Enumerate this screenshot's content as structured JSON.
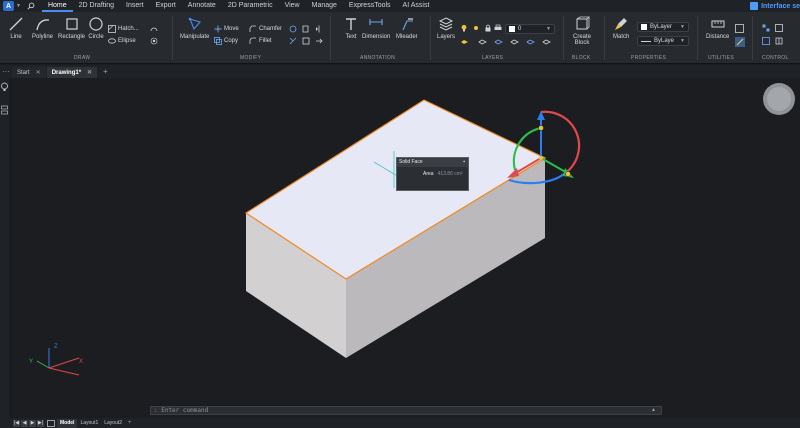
{
  "app": {
    "logo_letter": "A",
    "title_badge": "Interface se"
  },
  "menu": [
    "Home",
    "2D Drafting",
    "Insert",
    "Export",
    "Annotate",
    "2D Parametric",
    "View",
    "Manage",
    "ExpressTools",
    "AI Assist"
  ],
  "ribbon": {
    "draw": {
      "title": "DRAW",
      "line": "Line",
      "polyline": "Polyline",
      "rectangle": "Rectangle",
      "circle": "Circle",
      "hatch": "Hatch...",
      "ellipse": "Ellipse"
    },
    "modify": {
      "title": "MODIFY",
      "manipulate": "Manipulate",
      "move": "Move",
      "copy": "Copy",
      "chamfer": "Chamfer",
      "fillet": "Fillet"
    },
    "annotation": {
      "title": "ANNOTATION",
      "text": "Text",
      "dimension": "Dimension",
      "mleader": "Mleader"
    },
    "layers": {
      "title": "LAYERS",
      "layers": "Layers",
      "current_layer": "0"
    },
    "block": {
      "title": "BLOCK",
      "create": "Create",
      "block": "Block"
    },
    "properties": {
      "title": "PROPERTIES",
      "match": "Match",
      "color": "ByLayer",
      "linetype": "ByLaye"
    },
    "utilities": {
      "title": "UTILITIES",
      "distance": "Distance"
    },
    "control": {
      "title": "CONTROL"
    }
  },
  "doc_tabs": [
    {
      "label": "Start",
      "active": false
    },
    {
      "label": "Drawing1*",
      "active": true
    }
  ],
  "tooltip": {
    "title": "Solid Face",
    "key": "Area",
    "value": "413.86 cm²"
  },
  "ucs": {
    "x": "X",
    "y": "Y",
    "z": "Z"
  },
  "command": {
    "placeholder": ": Enter command"
  },
  "status": {
    "tabs": [
      "Model",
      "Layout1",
      "Layout2"
    ],
    "active": "Model"
  },
  "colors": {
    "accent": "#4d8df0",
    "selection": "#f08a24",
    "top_face": "#e6e8f6",
    "x_axis": "#e0494b",
    "y_axis": "#2bbf4a",
    "z_axis": "#2e7df0"
  }
}
